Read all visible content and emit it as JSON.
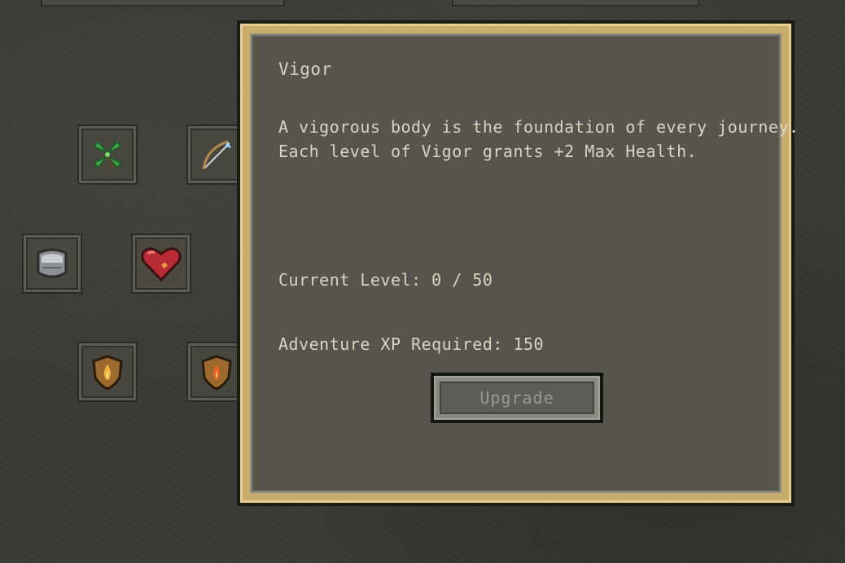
{
  "tooltip": {
    "title": "Vigor",
    "description": "A vigorous body is the foundation of every journey.\nEach level of Vigor grants +2 Max Health.",
    "current_level": "Current Level: 0 / 50",
    "xp_required": "Adventure XP Required: 150",
    "upgrade_label": "Upgrade"
  },
  "skill_tree": {
    "nodes": [
      {
        "name": "clover-skill",
        "icon": "four-leaf-clover-icon"
      },
      {
        "name": "bow-skill",
        "icon": "bow-arrow-icon"
      },
      {
        "name": "armor-skill",
        "icon": "chestplate-icon"
      },
      {
        "name": "vigor-skill",
        "icon": "heart-icon",
        "selected": true
      },
      {
        "name": "fire-shield-skill",
        "icon": "flame-shield-icon"
      },
      {
        "name": "fire-shield-skill-2",
        "icon": "flame-shield-icon"
      }
    ]
  },
  "colors": {
    "panel_gold": "#c9ad6d",
    "panel_fill": "#57544b",
    "text": "#d9d4c4",
    "heart": "#c0313a"
  }
}
